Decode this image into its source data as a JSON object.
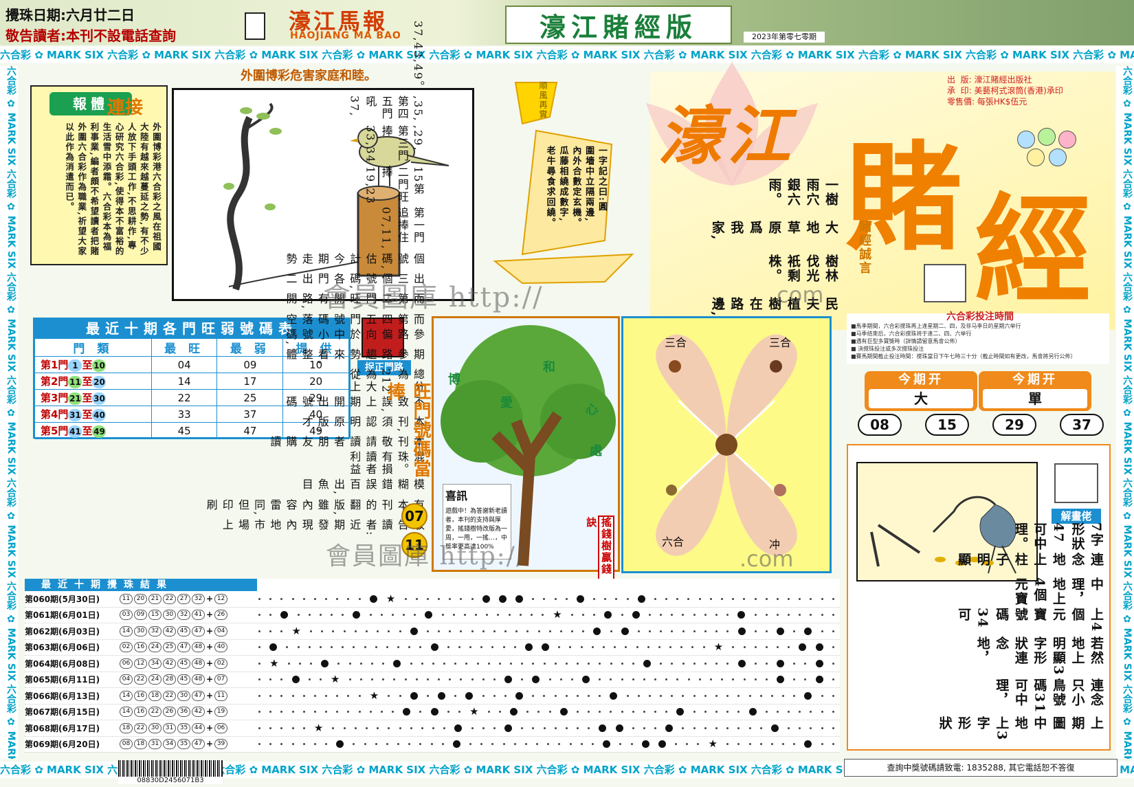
{
  "header": {
    "draw_date": "攪珠日期:六月廿二日",
    "notice": "敬告讀者:本刊不設電話查詢",
    "brand": "濠江馬報",
    "brand_en": "HAOJIANG MA BAO",
    "edition": "濠江賭經版",
    "issue": "2023年第零七零期"
  },
  "mark_text": "六合彩 ✿ MARK SIX ",
  "slogan": "外圍博彩危害家庭和睦。",
  "news": {
    "tag": "報體",
    "tag2": "連接",
    "body": "外圍博彩港六合彩之風在祖國大陸有越來越蔓延之勢,有不少人放下手頭工作,不思耕作,專心研究六合彩,使得本不富裕的生活雪中添霜。六合彩本為福利事業,編者頗不希望讀者把賭外圍六合彩作為職業,祈望大家以此作為消遣而已。"
  },
  "sail": {
    "flag": "順風再實",
    "poem": [
      "一字記之曰:圓",
      "圍墻中立隔兩邊,",
      "內外合數定玄機。",
      "瓜藤相繞成數字,",
      "老牛尋食求回繞。"
    ]
  },
  "publisher": {
    "line1": "出  版: 濠江賭經出版社",
    "line2": "承  印: 美藝柯式滾筒(香港)承印",
    "line3": "零售價: 每張HK$伍元"
  },
  "big_title": {
    "haojiang": "濠江",
    "du": "賭",
    "jing": "經"
  },
  "poem_lines": [
    "民夫植樹在路邊,",
    "樹林伐光衹剩株。",
    "大地草原爲我家,",
    "一樹雨穴銀六雨。"
  ],
  "poem_note": "賭經誠言",
  "hot_table": {
    "title": "最近十期各門旺弱號碼表",
    "headers": [
      "門 類",
      "最 旺",
      "最 弱",
      "提 供"
    ],
    "rows": [
      {
        "door": "第1門",
        "from": "1",
        "to": "10",
        "hot": "04",
        "cold": "09",
        "tip": "10"
      },
      {
        "door": "第2門",
        "from": "11",
        "to": "20",
        "hot": "14",
        "cold": "17",
        "tip": "20"
      },
      {
        "door": "第3門",
        "from": "21",
        "to": "30",
        "hot": "22",
        "cold": "25",
        "tip": "29"
      },
      {
        "door": "第4門",
        "from": "31",
        "to": "40",
        "hot": "33",
        "cold": "37",
        "tip": "40"
      },
      {
        "door": "第5門",
        "from": "41",
        "to": "49",
        "hot": "45",
        "cold": "47",
        "tip": "49"
      }
    ]
  },
  "catch_door": "捉正門路",
  "hot_door": {
    "title": "旺門號碼當捧",
    "nums": [
      "07",
      "11"
    ]
  },
  "notice_text": [
    "敬告讀者:近期發現內地市場上",
    "有本刊的翻版,雖內容雷同,但印刷",
    "模糊錯誤百出,魚目",
    "混珠。有損讀者利益",
    "本刊敬請讀者朋友購讀",
    "本刊,須認明原版,才",
    "不致誤,上期開出號碼",
    "總分為212為大從上",
    "期參路趨勢來看,整體",
    "參路偏向於中小號碼,",
    "而第四五門號碼落空",
    "而第二門旺開有路,開",
    "出三個號碼,各門出二",
    "個號碼,估計今期走勢",
    "第一門追捧住07,11,",
    "15第二門旺捧19,23",
    ",29,第三門捧33,34",
    ",35,第四五門吼37,",
    "37,43,49。"
  ],
  "tree": {
    "fruits": [
      "博",
      "愛",
      "和",
      "心",
      "處"
    ],
    "news_title": "喜訊",
    "news_body": "遊戲中！為答謝新老讀者，本刊的支持與厚愛，搖錢樹特改版為一周，一甩，一搖…，中獎率更高達100%",
    "label": "搖錢樹贏錢訣"
  },
  "zodiac": {
    "tl": "三合",
    "tr": "三合",
    "bl": "六合",
    "br": "冲"
  },
  "bet_time": {
    "title": "六合彩投注時間",
    "lines": [
      "■馬季期間，六合彩搅珠再上逢星期二、四，及非马季日的星期六举行",
      "■马季结束后，六合彩搅珠将于逢二、四、六举行",
      "■遇有巨型多寶獎時（詳情請留意馬會公佈）",
      "■ 決搅珠投注或多次搅珠投注",
      "■賽馬期間截止投注時間：搅珠當日下午七時三十分（截止時間如有更改，馬會將另行公佈）"
    ]
  },
  "this_issue": [
    {
      "label": "今期开",
      "value": "大"
    },
    {
      "label": "今期开",
      "value": "單"
    }
  ],
  "result_balls": [
    "08",
    "15",
    "29",
    "37"
  ],
  "solve": {
    "label": "解畫佬",
    "text": [
      "上期圖中地上3字形狀",
      "連念只小鳥號碼31可中理，",
      "若然地上明顯3字形狀連念地，",
      "上4個元寶號碼34可",
      "中理，地上4個元寶",
      "連念地上柱子明顯",
      "7字形狀47可中理。"
    ]
  },
  "results": {
    "title": "最近十期攪珠結果",
    "rows": [
      {
        "label": "第060期(5月30日)",
        "nums": [
          "11",
          "20",
          "21",
          "22",
          "27",
          "32"
        ],
        "special": "12"
      },
      {
        "label": "第061期(6月01日)",
        "nums": [
          "03",
          "09",
          "15",
          "30",
          "32",
          "41"
        ],
        "special": "26"
      },
      {
        "label": "第062期(6月03日)",
        "nums": [
          "14",
          "30",
          "32",
          "42",
          "45",
          "47"
        ],
        "special": "04"
      },
      {
        "label": "第063期(6月06日)",
        "nums": [
          "02",
          "16",
          "24",
          "25",
          "47",
          "48"
        ],
        "special": "40"
      },
      {
        "label": "第064期(6月08日)",
        "nums": [
          "06",
          "12",
          "34",
          "42",
          "45",
          "48"
        ],
        "special": "02"
      },
      {
        "label": "第065期(6月11日)",
        "nums": [
          "04",
          "22",
          "24",
          "28",
          "45",
          "48"
        ],
        "special": "07"
      },
      {
        "label": "第066期(6月13日)",
        "nums": [
          "14",
          "16",
          "18",
          "22",
          "30",
          "47"
        ],
        "special": "11"
      },
      {
        "label": "第067期(6月15日)",
        "nums": [
          "14",
          "16",
          "22",
          "26",
          "36",
          "42"
        ],
        "special": "19"
      },
      {
        "label": "第068期(6月17日)",
        "nums": [
          "18",
          "22",
          "30",
          "31",
          "35",
          "44"
        ],
        "special": "06"
      },
      {
        "label": "第069期(6月20日)",
        "nums": [
          "08",
          "18",
          "31",
          "34",
          "35",
          "47"
        ],
        "special": "39"
      }
    ]
  },
  "barcode_number": "08830D2456071B3",
  "bottom_note": "查詢中獎號碼請致電: 1835288, 其它電話恕不答復",
  "watermark": {
    "text1": "會員圖庫 http://",
    "text2": ".com",
    "text3": "會員圖庫 http://",
    "text4": ".com"
  },
  "colors": {
    "accent": "#f08000",
    "blue": "#1b8fd0",
    "green": "#1a7f3a",
    "red": "#c00000"
  }
}
